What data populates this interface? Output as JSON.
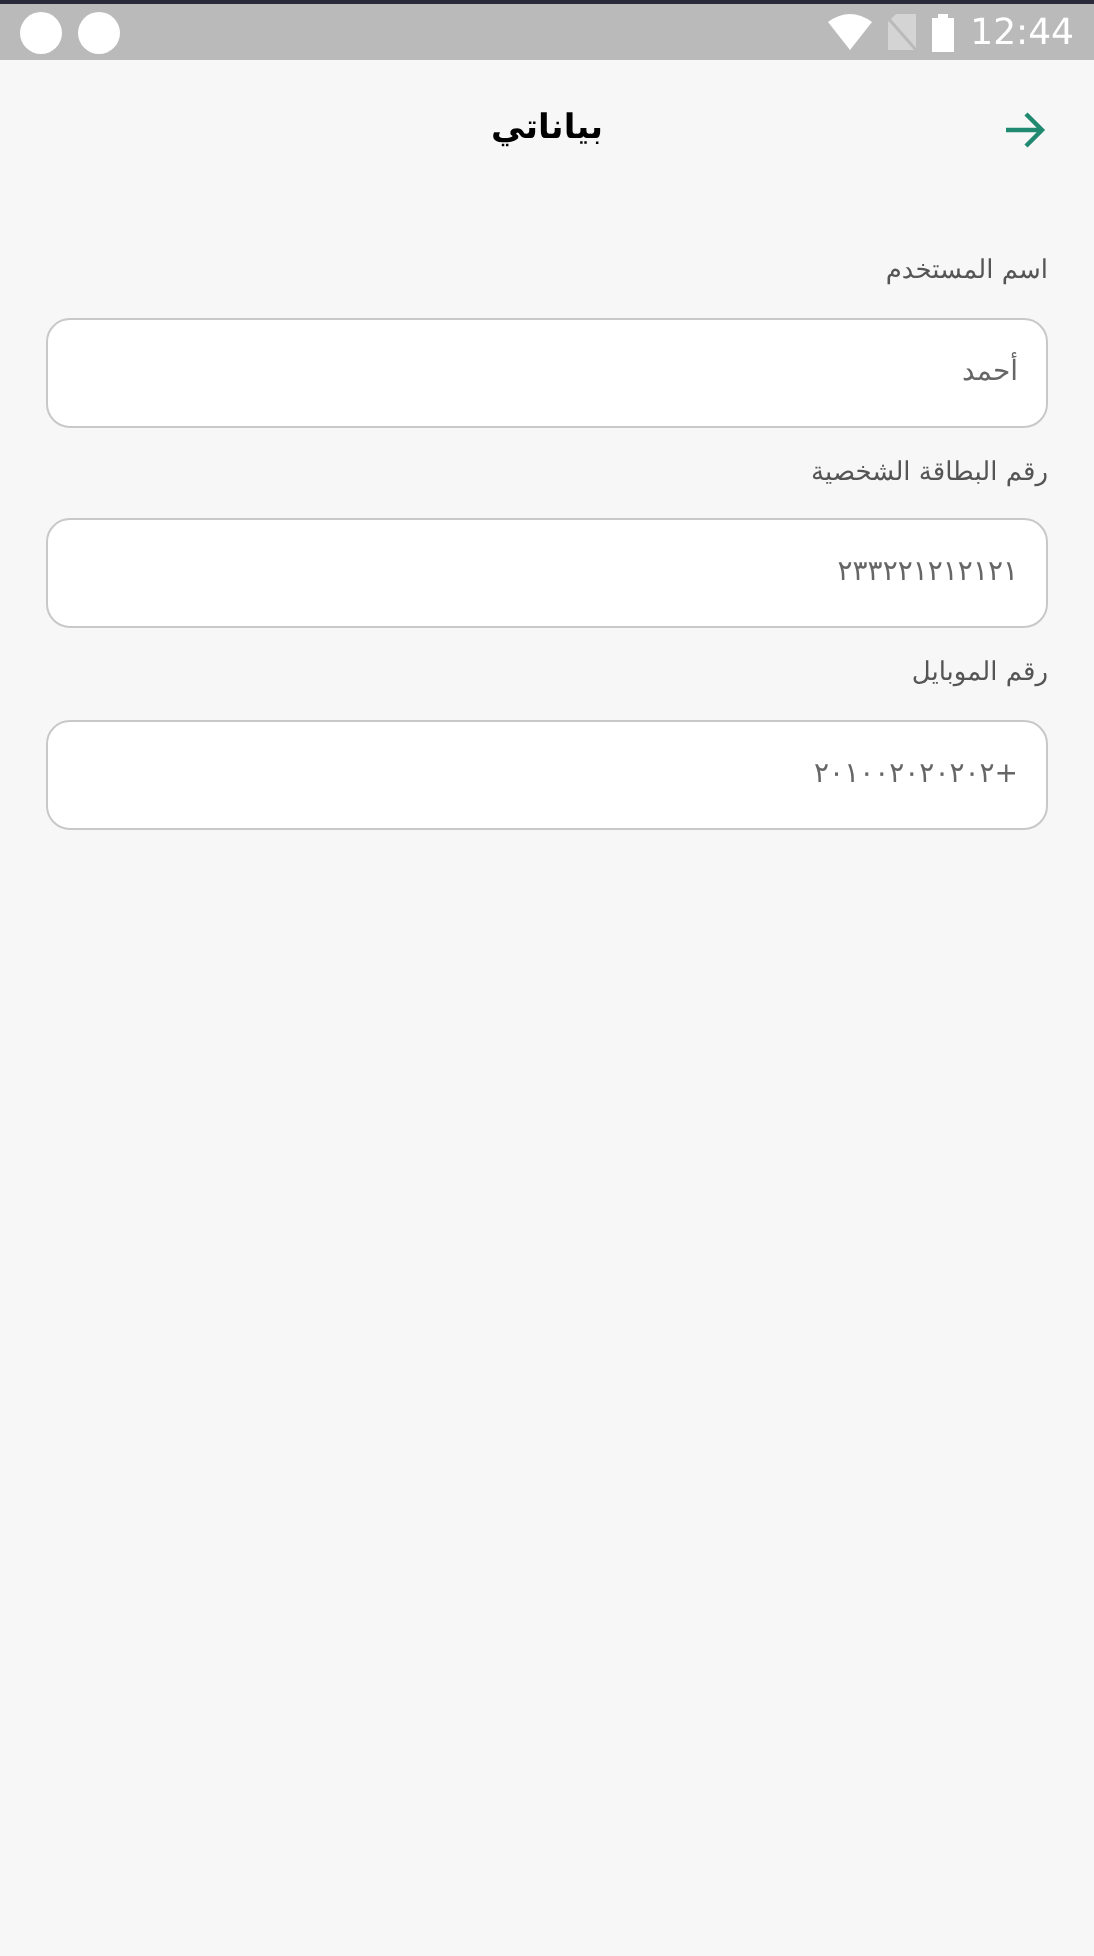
{
  "status_bar": {
    "time": "12:44"
  },
  "header": {
    "title": "بياناتي"
  },
  "fields": [
    {
      "label": "اسم المستخدم",
      "value": "أحمد"
    },
    {
      "label": "رقم البطاقة الشخصية",
      "value": "٢٣٣٢٢١٢١٢١٢١"
    },
    {
      "label": "رقم الموبايل",
      "value": "+٢٠١٠٠٢٠٢٠٢٠٢"
    }
  ]
}
